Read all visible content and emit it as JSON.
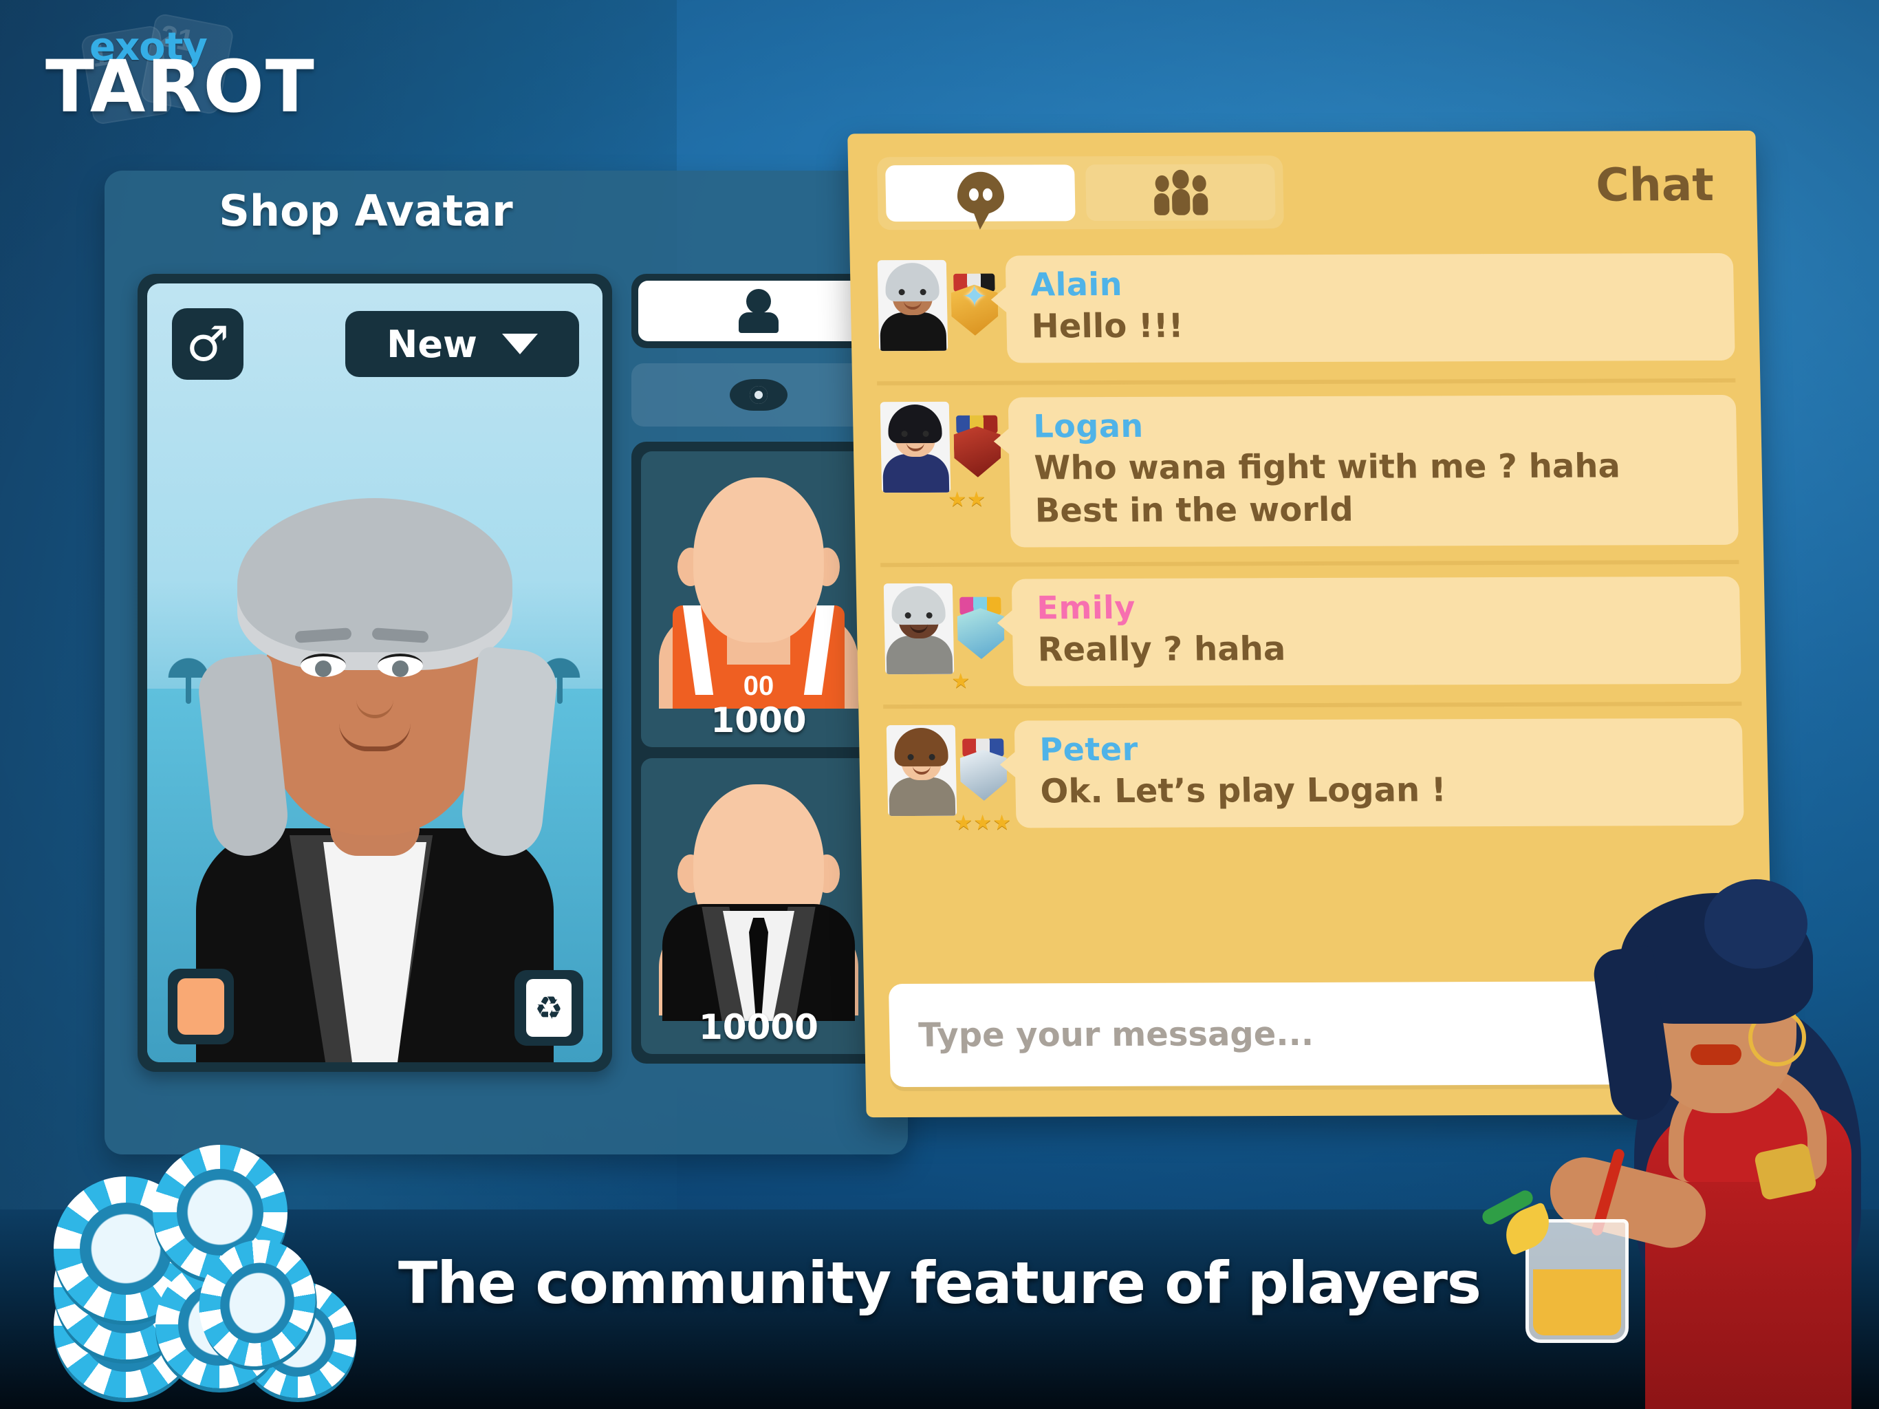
{
  "app": {
    "logo_brand": "exoty",
    "logo_title": "TAROT",
    "logo_card_1": "1",
    "logo_card_2": "21"
  },
  "shop": {
    "title": "Shop Avatar",
    "gender_icon": "male-gender-icon",
    "sort_label": "New",
    "caret_icon": "chevron-down-icon",
    "swatch_color": "#f9a974",
    "reset_icon": "recycle-icon",
    "tabs": [
      {
        "icon": "person-silhouette-icon",
        "active": true
      }
    ],
    "preview_icon": "eye-icon",
    "items": [
      {
        "name": "orange-jersey",
        "price": "1000",
        "jersey_number": "00"
      },
      {
        "name": "black-tuxedo",
        "price": "10000"
      }
    ]
  },
  "chat": {
    "title": "Chat",
    "tabs": [
      {
        "name": "chat-tab",
        "icon": "chat-bubble-icon",
        "active": true
      },
      {
        "name": "players-tab",
        "icon": "group-people-icon",
        "active": false
      }
    ],
    "messages": [
      {
        "sender": "Alain",
        "gender": "male",
        "lines": [
          "Hello !!!"
        ],
        "badge": "star-medal",
        "badge_color": "#8fd4f0",
        "stars": 0,
        "hair": "#c9cfd3",
        "skin": "#b87a52",
        "outfit": "#141414"
      },
      {
        "sender": "Logan",
        "gender": "male",
        "lines": [
          "Who wana fight with me ? haha",
          "Best in the world"
        ],
        "badge": "shield-medal",
        "badge_color": "#a3281f",
        "stars": 2,
        "hair": "#17171c",
        "skin": "#f0c09a",
        "outfit": "#27336e"
      },
      {
        "sender": "Emily",
        "gender": "female",
        "lines": [
          "Really ? haha"
        ],
        "badge": "gem-medal",
        "badge_color": "#9fe4e0",
        "stars": 1,
        "hair": "#cfd4d6",
        "skin": "#6b3f2a",
        "outfit": "#7c7c78"
      },
      {
        "sender": "Peter",
        "gender": "male",
        "lines": [
          "Ok. Let’s play Logan !"
        ],
        "badge": "pillar-medal",
        "badge_color": "#dfe6ea",
        "stars": 3,
        "hair": "#7a4a25",
        "skin": "#f2c49d",
        "outfit": "#8b8272"
      }
    ],
    "compose_placeholder": "Type your message..."
  },
  "banner": {
    "tagline": "The community feature of players"
  },
  "colors": {
    "chat_panel": "#f1c96a",
    "chat_bubble": "#fae0a8",
    "chat_text": "#7a5b2e",
    "male_name": "#4fb3e8",
    "female_name": "#f76fb0",
    "shop_panel": "#296486",
    "accent_blue": "#35aee6"
  }
}
